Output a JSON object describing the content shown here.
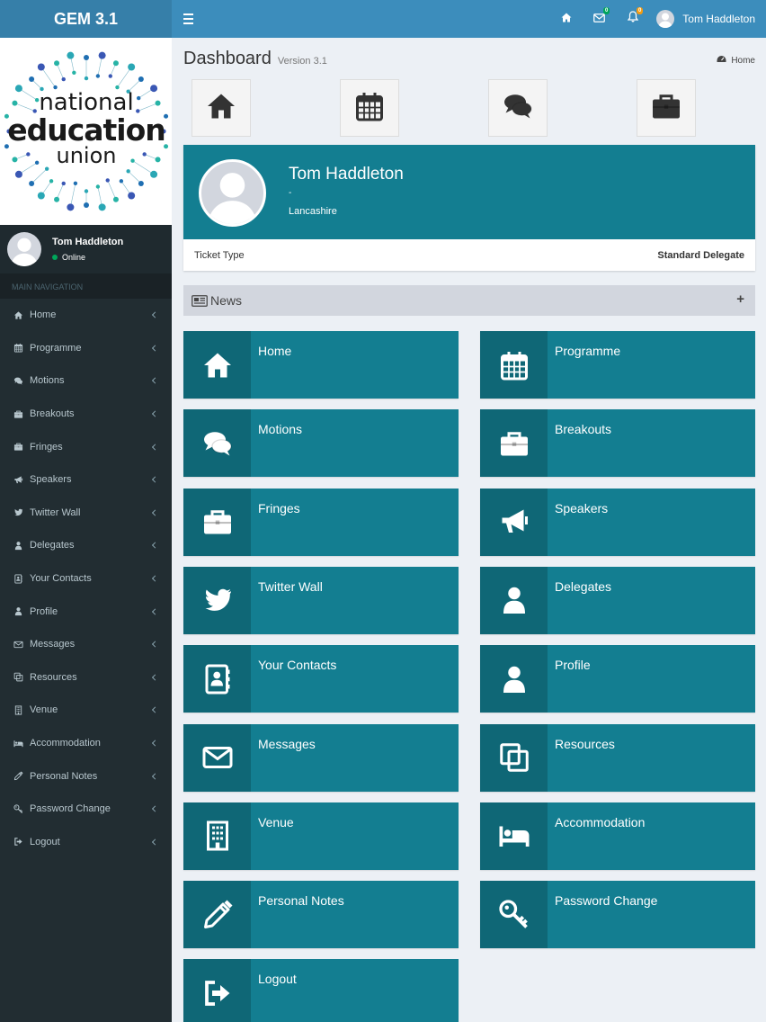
{
  "app": {
    "title": "GEM 3.1"
  },
  "topbar": {
    "messages_count": "0",
    "notifications_count": "0",
    "user_name": "Tom Haddleton",
    "icons": [
      "home-icon",
      "envelope-icon",
      "bell-icon"
    ]
  },
  "sidebar": {
    "user": {
      "name": "Tom Haddleton",
      "status": "Online"
    },
    "logo_words": {
      "line1": "national",
      "line2": "education",
      "line3": "union"
    },
    "nav_header": "MAIN NAVIGATION",
    "items": [
      {
        "label": "Home",
        "icon": "home-icon"
      },
      {
        "label": "Programme",
        "icon": "calendar-icon"
      },
      {
        "label": "Motions",
        "icon": "comments-icon"
      },
      {
        "label": "Breakouts",
        "icon": "briefcase-icon"
      },
      {
        "label": "Fringes",
        "icon": "briefcase-icon"
      },
      {
        "label": "Speakers",
        "icon": "bullhorn-icon"
      },
      {
        "label": "Twitter Wall",
        "icon": "twitter-icon"
      },
      {
        "label": "Delegates",
        "icon": "user-icon"
      },
      {
        "label": "Your Contacts",
        "icon": "address-book-icon"
      },
      {
        "label": "Profile",
        "icon": "user-icon"
      },
      {
        "label": "Messages",
        "icon": "envelope-icon"
      },
      {
        "label": "Resources",
        "icon": "copy-icon"
      },
      {
        "label": "Venue",
        "icon": "building-icon"
      },
      {
        "label": "Accommodation",
        "icon": "bed-icon"
      },
      {
        "label": "Personal Notes",
        "icon": "pencil-icon"
      },
      {
        "label": "Password Change",
        "icon": "key-icon"
      },
      {
        "label": "Logout",
        "icon": "sign-out-icon"
      }
    ]
  },
  "main": {
    "title": "Dashboard",
    "version": "Version 3.1",
    "breadcrumb": "Home",
    "quick_links": [
      "home-icon",
      "calendar-icon",
      "comments-icon",
      "briefcase-icon"
    ],
    "profile": {
      "name": "Tom Haddleton",
      "subtitle": "-",
      "location": "Lancashire",
      "field_label": "Ticket Type",
      "field_value": "Standard Delegate"
    },
    "news": {
      "label": "News",
      "toggle": "+"
    },
    "tiles": [
      {
        "label": "Home",
        "icon": "home-icon"
      },
      {
        "label": "Programme",
        "icon": "calendar-icon"
      },
      {
        "label": "Motions",
        "icon": "comments-icon"
      },
      {
        "label": "Breakouts",
        "icon": "briefcase-icon"
      },
      {
        "label": "Fringes",
        "icon": "briefcase-icon"
      },
      {
        "label": "Speakers",
        "icon": "bullhorn-icon"
      },
      {
        "label": "Twitter Wall",
        "icon": "twitter-icon"
      },
      {
        "label": "Delegates",
        "icon": "user-icon"
      },
      {
        "label": "Your Contacts",
        "icon": "address-book-icon"
      },
      {
        "label": "Profile",
        "icon": "user-icon"
      },
      {
        "label": "Messages",
        "icon": "envelope-icon"
      },
      {
        "label": "Resources",
        "icon": "copy-icon"
      },
      {
        "label": "Venue",
        "icon": "building-icon"
      },
      {
        "label": "Accommodation",
        "icon": "bed-icon"
      },
      {
        "label": "Personal Notes",
        "icon": "pencil-icon"
      },
      {
        "label": "Password Change",
        "icon": "key-icon"
      },
      {
        "label": "Logout",
        "icon": "sign-out-icon"
      }
    ]
  },
  "colors": {
    "topbar": "#3c8dbc",
    "logo_bar": "#367fa9",
    "sidebar": "#222d32",
    "tile": "#137e91",
    "online": "#00a65a"
  }
}
